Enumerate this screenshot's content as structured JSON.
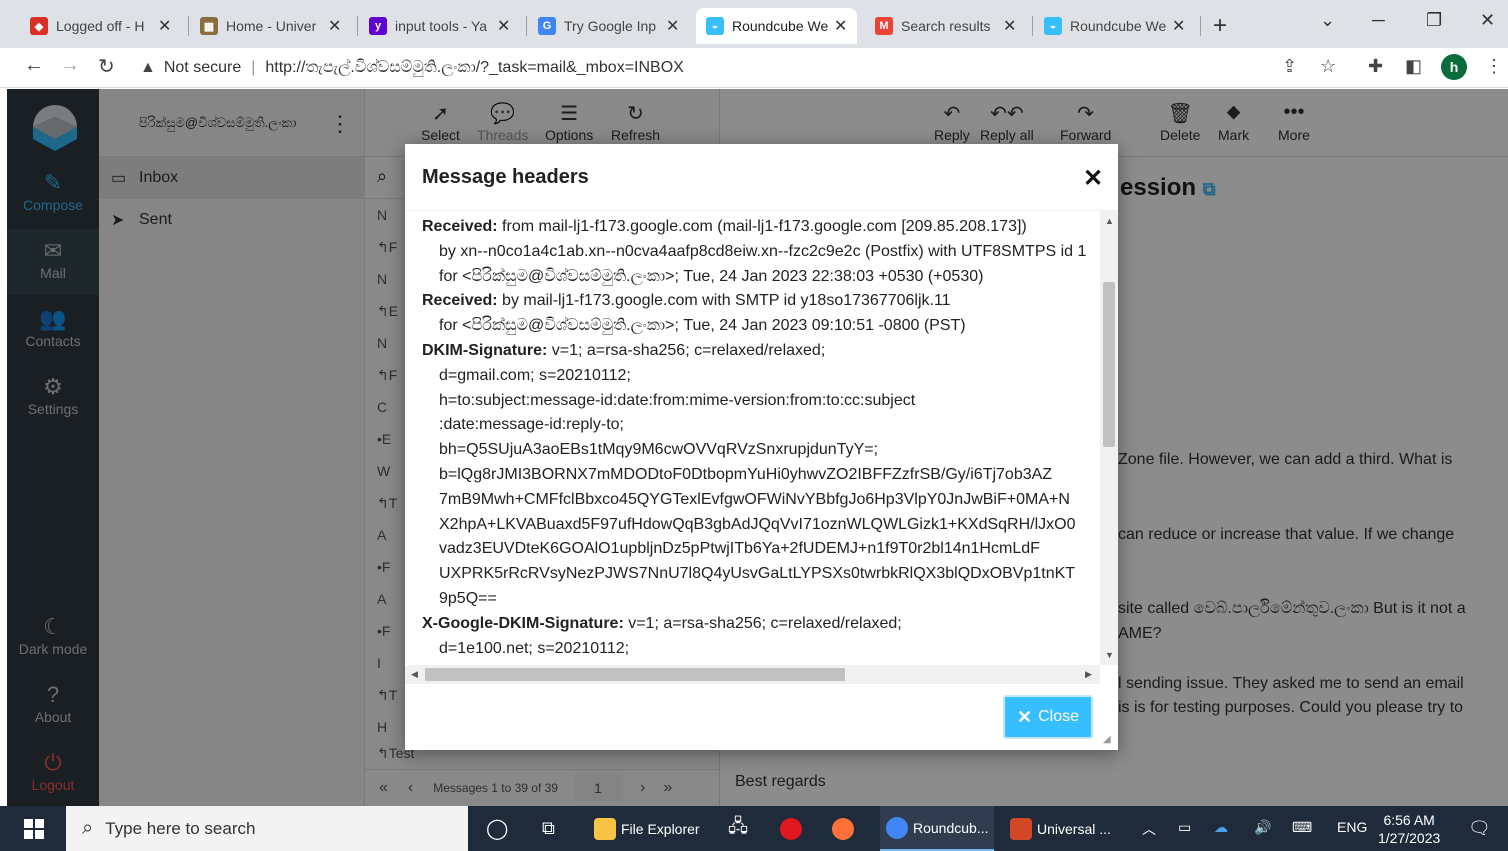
{
  "browser": {
    "tabs": [
      {
        "title": "Logged off - H",
        "fav_color": "#d93025",
        "fav_text": "◆"
      },
      {
        "title": "Home - Univer",
        "fav_color": "#8a6d3b",
        "fav_text": "▦"
      },
      {
        "title": "input tools - Ya",
        "fav_color": "#5f01d1",
        "fav_text": "y"
      },
      {
        "title": "Try Google Inp",
        "fav_color": "#4285f4",
        "fav_text": "G"
      },
      {
        "title": "Roundcube We",
        "fav_color": "#37beff",
        "fav_text": "◒"
      },
      {
        "title": "Search results",
        "fav_color": "#ea4335",
        "fav_text": "M"
      },
      {
        "title": "Roundcube We",
        "fav_color": "#37beff",
        "fav_text": "◒"
      }
    ],
    "not_secure": "Not secure",
    "url": "http://තැපැල්.විශ්වසම්මුති.ලංකා/?_task=mail&_mbox=INBOX",
    "profile_initial": "h"
  },
  "rail": {
    "compose": "Compose",
    "mail": "Mail",
    "contacts": "Contacts",
    "settings": "Settings",
    "dark_mode": "Dark mode",
    "about": "About",
    "logout": "Logout"
  },
  "folders": {
    "account": "පිරික්සුම@විශ්වසම්මුති.ලංකා",
    "items": [
      {
        "label": "Inbox"
      },
      {
        "label": "Sent"
      }
    ]
  },
  "list_toolbar": {
    "select": "Select",
    "threads": "Threads",
    "options": "Options",
    "refresh": "Refresh"
  },
  "list_rows": [
    "N",
    "F",
    "N",
    "E",
    "N",
    "F",
    "C",
    "E",
    "W",
    "T",
    "A",
    "F",
    "A",
    "F",
    "I",
    "T",
    "H",
    "Test"
  ],
  "list_footer": {
    "count_text": "Messages 1 to 39 of 39",
    "page": "1"
  },
  "reader_toolbar": {
    "reply": "Reply",
    "reply_all": "Reply all",
    "forward": "Forward",
    "delete": "Delete",
    "mark": "Mark",
    "more": "More"
  },
  "reader": {
    "subject_fragment": "ession",
    "body_lines": [
      "Zone file. However, we can add a third. What is",
      "can reduce or increase that value. If we change",
      "site called වෙබ්.පාර්ලිමේන්තුව.ලංකා But is it not a",
      "AME?",
      "l sending issue. They asked me to send an email",
      "is is for testing purposes. Could you please try to"
    ],
    "regards": "Best regards"
  },
  "dialog": {
    "title": "Message headers",
    "close_label": "Close",
    "header_lines": [
      {
        "key": "Received:",
        "value": " from mail-lj1-f173.google.com (mail-lj1-f173.google.com [209.85.208.173])"
      },
      {
        "key": "",
        "value": "by xn--n0co1a4c1ab.xn--n0cva4aafp8cd8eiw.xn--fzc2c9e2c (Postfix) with UTF8SMTPS id 1"
      },
      {
        "key": "",
        "value": "for <පිරික්සුම@විශ්වසම්මුති.ලංකා>; Tue, 24 Jan 2023 22:38:03 +0530 (+0530)"
      },
      {
        "key": "Received:",
        "value": " by mail-lj1-f173.google.com with SMTP id y18so17367706ljk.11"
      },
      {
        "key": "",
        "value": "for <පිරික්සුම@විශ්වසම්මුති.ලංකා>; Tue, 24 Jan 2023 09:10:51 -0800 (PST)"
      },
      {
        "key": "DKIM-Signature:",
        "value": " v=1; a=rsa-sha256; c=relaxed/relaxed;"
      },
      {
        "key": "",
        "value": "d=gmail.com; s=20210112;"
      },
      {
        "key": "",
        "value": "h=to:subject:message-id:date:from:mime-version:from:to:cc:subject"
      },
      {
        "key": "",
        "value": ":date:message-id:reply-to;"
      },
      {
        "key": "",
        "value": "bh=Q5SUjuA3aoEBs1tMqy9M6cwOVVqRVzSnxrupjdunTyY=;"
      },
      {
        "key": "",
        "value": "b=lQg8rJMI3BORNX7mMDODtoF0DtbopmYuHi0yhwvZO2IBFFZzfrSB/Gy/i6Tj7ob3AZ"
      },
      {
        "key": "",
        "value": "7mB9Mwh+CMFfclBbxco45QYGTexlEvfgwOFWiNvYBbfgJo6Hp3VlpY0JnJwBiF+0MA+N"
      },
      {
        "key": "",
        "value": "X2hpA+LKVABuaxd5F97ufHdowQqB3gbAdJQqVvI71oznWLQWLGizk1+KXdSqRH/lJxO0"
      },
      {
        "key": "",
        "value": "vadz3EUVDteK6GOAlO1upbljnDz5pPtwjITb6Ya+2fUDEMJ+n1f9T0r2bl14n1HcmLdF"
      },
      {
        "key": "",
        "value": "UXPRK5rRcRVsyNezPJWS7NnU7l8Q4yUsvGaLtLYPSXs0twrbkRlQX3blQDxOBVp1tnKT"
      },
      {
        "key": "",
        "value": "9p5Q=="
      },
      {
        "key": "X-Google-DKIM-Signature:",
        "value": " v=1; a=rsa-sha256; c=relaxed/relaxed;"
      },
      {
        "key": "",
        "value": "d=1e100.net; s=20210112;"
      }
    ]
  },
  "taskbar": {
    "search_placeholder": "Type here to search",
    "file_explorer": "File Explorer",
    "roundcube": "Roundcub...",
    "universal": "Universal ...",
    "lang": "ENG",
    "time": "6:56 AM",
    "date": "1/27/2023"
  }
}
